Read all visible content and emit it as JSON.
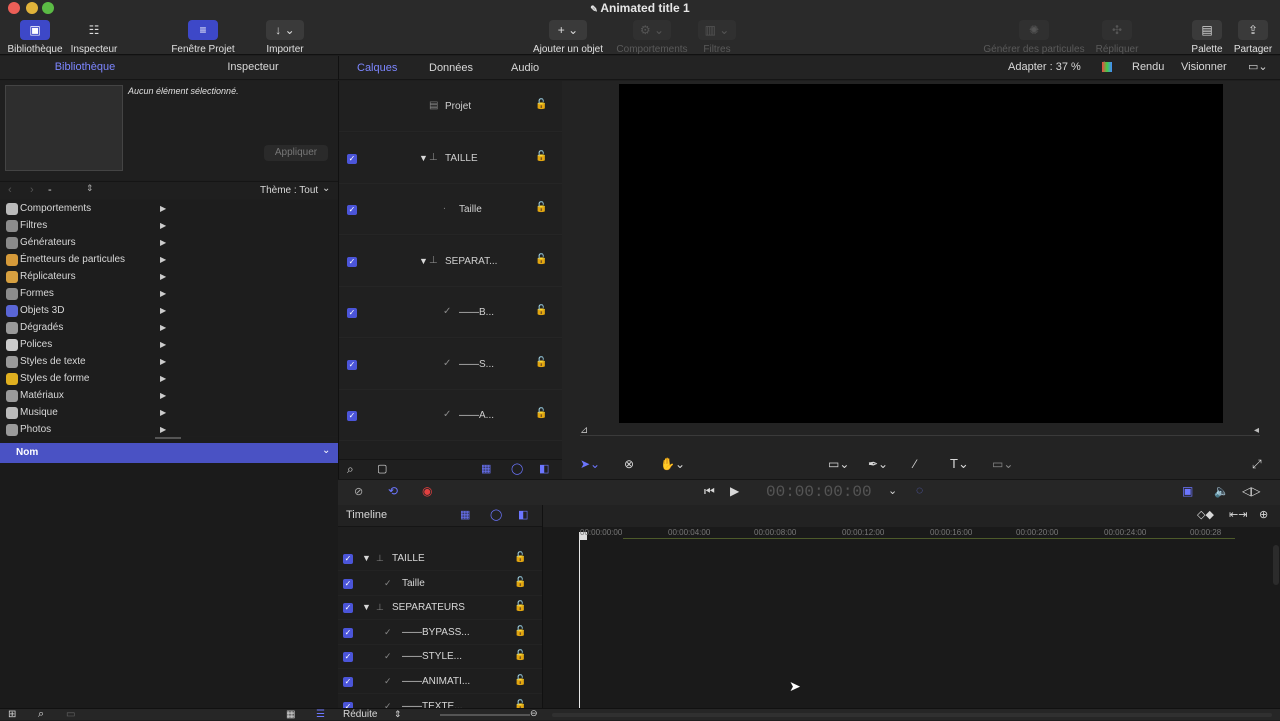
{
  "window": {
    "title": "Animated title 1"
  },
  "toolbar": {
    "library": "Bibliothèque",
    "inspector": "Inspecteur",
    "project": "Fenêtre Projet",
    "import": "Importer",
    "add_object": "Ajouter un objet",
    "behaviors": "Comportements",
    "filters": "Filtres",
    "particles": "Générer des particules",
    "replicate": "Répliquer",
    "palette": "Palette",
    "share": "Partager"
  },
  "left_tabs": {
    "library": "Bibliothèque",
    "inspector": "Inspecteur"
  },
  "preview": {
    "message": "Aucun élément sélectionné.",
    "apply": "Appliquer"
  },
  "nav": {
    "dash": "-",
    "theme": "Thème : Tout"
  },
  "library_items": [
    {
      "label": "Comportements",
      "icon": "gear-icon",
      "color": "#bbbbbb"
    },
    {
      "label": "Filtres",
      "icon": "filter-icon",
      "color": "#8c8c8c"
    },
    {
      "label": "Générateurs",
      "icon": "generator-icon",
      "color": "#8a8a8a"
    },
    {
      "label": "Émetteurs de particules",
      "icon": "particle-icon",
      "color": "#d59a3a"
    },
    {
      "label": "Réplicateurs",
      "icon": "replicator-icon",
      "color": "#d7a040"
    },
    {
      "label": "Formes",
      "icon": "shape-icon",
      "color": "#8c8c8c"
    },
    {
      "label": "Objets 3D",
      "icon": "cube-icon",
      "color": "#5a66d6"
    },
    {
      "label": "Dégradés",
      "icon": "gradient-icon",
      "color": "#9a9a9a"
    },
    {
      "label": "Polices",
      "icon": "font-icon",
      "color": "#cccccc"
    },
    {
      "label": "Styles de texte",
      "icon": "text-style-icon",
      "color": "#9a9a9a"
    },
    {
      "label": "Styles de forme",
      "icon": "shape-style-icon",
      "color": "#e0b020"
    },
    {
      "label": "Matériaux",
      "icon": "material-icon",
      "color": "#9a9a9a"
    },
    {
      "label": "Musique",
      "icon": "music-icon",
      "color": "#bbbbbb"
    },
    {
      "label": "Photos",
      "icon": "photo-icon",
      "color": "#9a9a9a"
    }
  ],
  "list_header": {
    "name": "Nom"
  },
  "layer_tabs": {
    "layers": "Calques",
    "data": "Données",
    "audio": "Audio"
  },
  "layers": [
    "Projet",
    "TAILLE",
    "Taille",
    "SEPARAT...",
    "——B...",
    "——S...",
    "——A..."
  ],
  "canvas_bar": {
    "fit": "Adapter : 37 %",
    "render": "Rendu",
    "view": "Visionner"
  },
  "transport": {
    "timecode": "00:00:00:00"
  },
  "timeline": {
    "label": "Timeline",
    "rows": [
      "TAILLE",
      "Taille",
      "SEPARATEURS",
      "——BYPASS...",
      "——STYLE...",
      "——ANIMATI...",
      "——TEXTE..."
    ],
    "ticks": [
      "00:00:00:00",
      "00:00:04:00",
      "00:00:08:00",
      "00:00:12:00",
      "00:00:16:00",
      "00:00:20:00",
      "00:00:24:00",
      "00:00:28"
    ]
  },
  "bottom": {
    "reduce": "Réduite"
  }
}
